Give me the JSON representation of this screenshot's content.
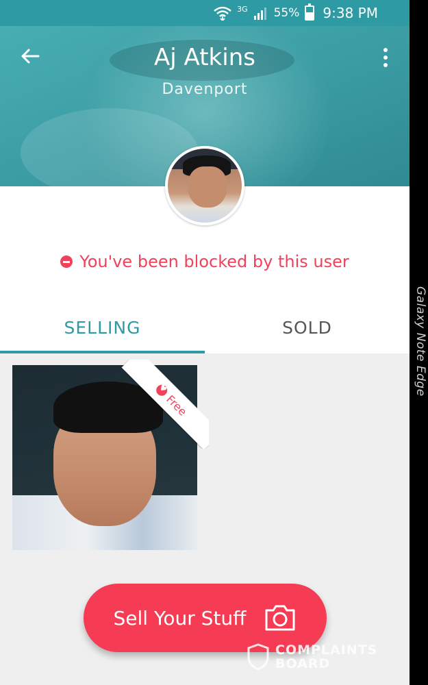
{
  "status_bar": {
    "network": "3G",
    "battery_percent": "55%",
    "battery_level": 0.55,
    "time": "9:38 PM"
  },
  "header": {
    "name": "Aj Atkins",
    "location": "Davenport"
  },
  "blocked_notice": "You've been blocked by this user",
  "tabs": [
    {
      "label": "SELLING",
      "selected": true
    },
    {
      "label": "SOLD",
      "selected": false
    }
  ],
  "listing": {
    "badge": "Free"
  },
  "sell_button": {
    "label": "Sell Your Stuff"
  },
  "device_label": "Galaxy Note Edge",
  "watermark": {
    "line1": "COMPLAINTS",
    "line2": "BOARD"
  },
  "colors": {
    "primary_teal": "#2e9aa3",
    "accent_red": "#f63b55"
  }
}
